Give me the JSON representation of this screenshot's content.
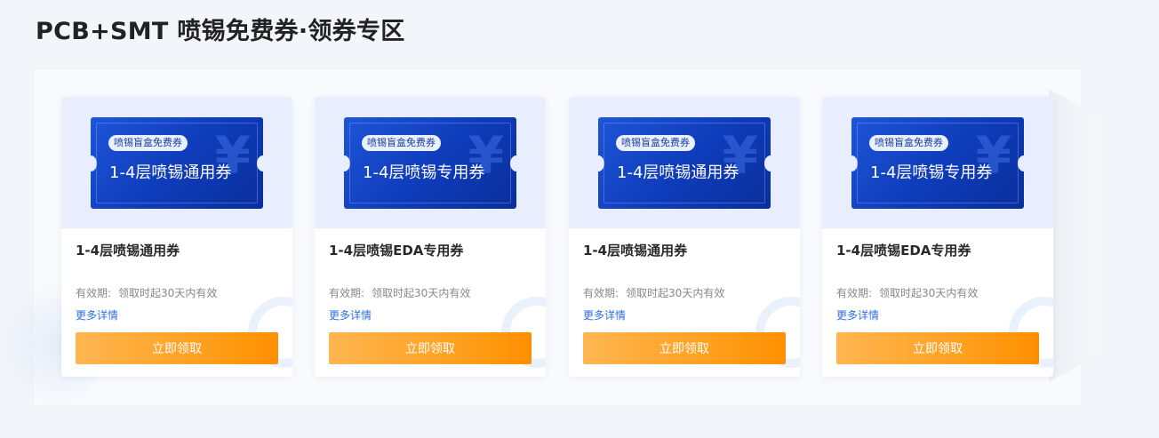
{
  "page": {
    "title": "PCB+SMT 喷锡免费券·领券专区"
  },
  "coupons": [
    {
      "tag": "喷锡盲盒免费券",
      "ticket_name": "1-4层喷锡通用券",
      "yen": "¥",
      "title": "1-4层喷锡通用券",
      "validity_label": "有效期:",
      "validity_value": "领取时起30天内有效",
      "more_link": "更多详情",
      "button": "立即领取"
    },
    {
      "tag": "喷锡盲盒免费券",
      "ticket_name": "1-4层喷锡专用券",
      "yen": "¥",
      "title": "1-4层喷锡EDA专用券",
      "validity_label": "有效期:",
      "validity_value": "领取时起30天内有效",
      "more_link": "更多详情",
      "button": "立即领取"
    },
    {
      "tag": "喷锡盲盒免费券",
      "ticket_name": "1-4层喷锡通用券",
      "yen": "¥",
      "title": "1-4层喷锡通用券",
      "validity_label": "有效期:",
      "validity_value": "领取时起30天内有效",
      "more_link": "更多详情",
      "button": "立即领取"
    },
    {
      "tag": "喷锡盲盒免费券",
      "ticket_name": "1-4层喷锡专用券",
      "yen": "¥",
      "title": "1-4层喷锡EDA专用券",
      "validity_label": "有效期:",
      "validity_value": "领取时起30天内有效",
      "more_link": "更多详情",
      "button": "立即领取"
    }
  ],
  "colors": {
    "accent_orange": "#ff9d19",
    "ticket_blue": "#0e3bb8",
    "link_blue": "#2d6fe0"
  }
}
